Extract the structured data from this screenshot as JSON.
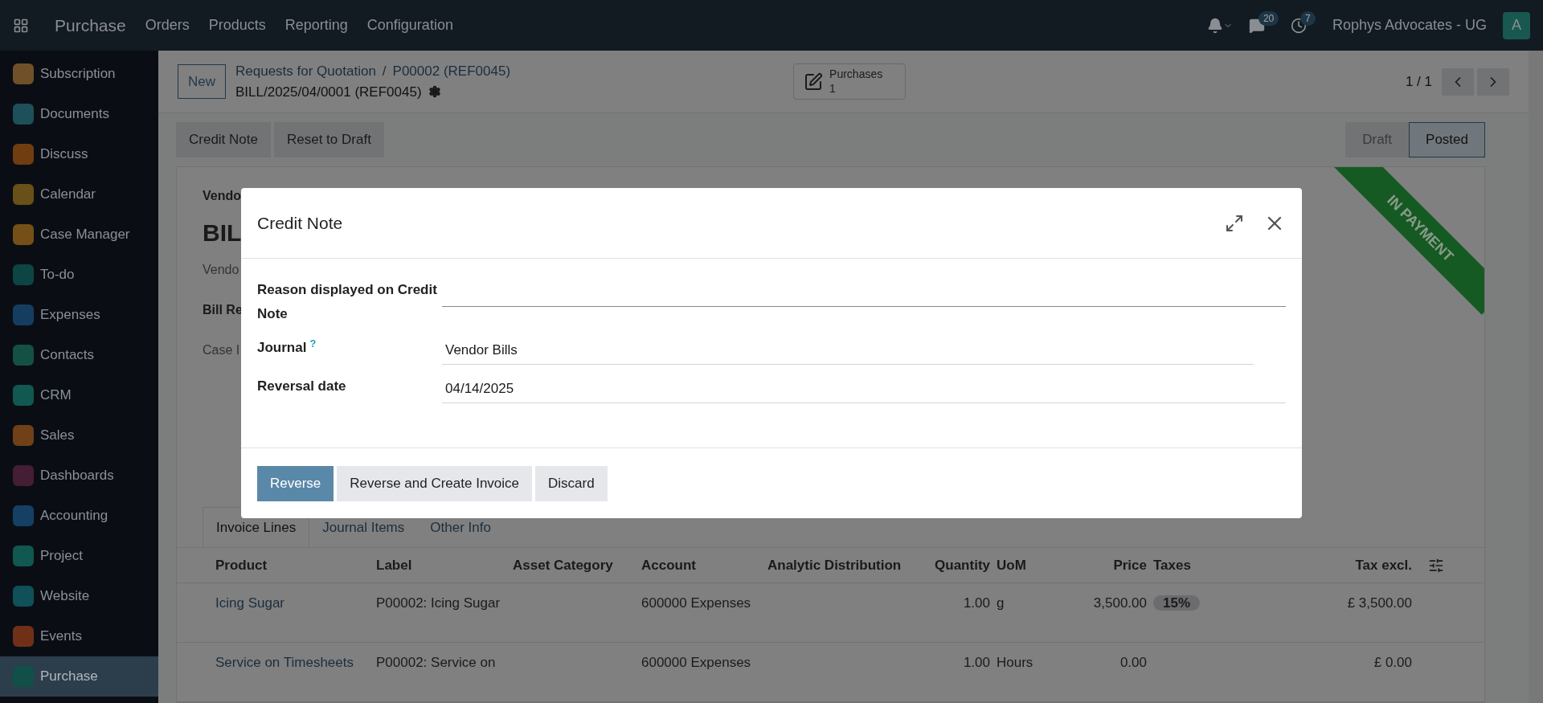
{
  "topbar": {
    "app": "Purchase",
    "menu": [
      "Orders",
      "Products",
      "Reporting",
      "Configuration"
    ],
    "messages_count": "20",
    "activities_count": "7",
    "company": "Rophys Advocates - UG",
    "avatar": "A"
  },
  "sidebar": {
    "items": [
      {
        "label": "Subscription",
        "color": "#705028",
        "selected": false
      },
      {
        "label": "Documents",
        "color": "#1d5058",
        "selected": false
      },
      {
        "label": "Discuss",
        "color": "#703d10",
        "selected": false
      },
      {
        "label": "Calendar",
        "color": "#685018",
        "selected": false
      },
      {
        "label": "Case Manager",
        "color": "#745018",
        "selected": false
      },
      {
        "label": "To-do",
        "color": "#0d4545",
        "selected": false
      },
      {
        "label": "Expenses",
        "color": "#153d60",
        "selected": false
      },
      {
        "label": "Contacts",
        "color": "#155045",
        "selected": false
      },
      {
        "label": "CRM",
        "color": "#105850",
        "selected": false
      },
      {
        "label": "Sales",
        "color": "#704018",
        "selected": false
      },
      {
        "label": "Dashboards",
        "color": "#451d35",
        "selected": false
      },
      {
        "label": "Accounting",
        "color": "#154064",
        "selected": false
      },
      {
        "label": "Project",
        "color": "#105850",
        "selected": false
      },
      {
        "label": "Website",
        "color": "#105058",
        "selected": false
      },
      {
        "label": "Events",
        "color": "#703018",
        "selected": false
      },
      {
        "label": "Purchase",
        "color": "#105048",
        "selected": true
      }
    ]
  },
  "control_panel": {
    "new_button": "New",
    "breadcrumb": [
      "Requests for Quotation",
      "P00002 (REF0045)"
    ],
    "breadcrumb_separator": "/",
    "record": "BILL/2025/04/0001 (REF0045)",
    "smart_button": {
      "label": "Purchases",
      "count": "1"
    },
    "pager": "1 / 1"
  },
  "actions": [
    "Credit Note",
    "Reset to Draft"
  ],
  "status_steps": [
    {
      "label": "Draft",
      "selected": false
    },
    {
      "label": "Posted",
      "selected": true
    }
  ],
  "ribbon": "IN PAYMENT",
  "form_labels": [
    "Vendo",
    "Vendo",
    "Bill Re",
    "Case I"
  ],
  "form_title": "BIL",
  "tabs": [
    {
      "label": "Invoice Lines",
      "selected": true
    },
    {
      "label": "Journal Items",
      "selected": false
    },
    {
      "label": "Other Info",
      "selected": false
    }
  ],
  "table": {
    "columns": [
      "Product",
      "Label",
      "Asset Category",
      "Account",
      "Analytic Distribution",
      "Quantity",
      "UoM",
      "Price",
      "Taxes",
      "Tax excl."
    ],
    "rows": [
      {
        "product": "Icing Sugar",
        "label": "P00002: Icing Sugar",
        "account": "600000 Expenses",
        "quantity": "1.00",
        "uom": "g",
        "price": "3,500.00",
        "taxes": "15%",
        "total": "£ 3,500.00"
      },
      {
        "product": "Service on Timesheets",
        "label": "P00002: Service on",
        "account": "600000 Expenses",
        "quantity": "1.00",
        "uom": "Hours",
        "price": "0.00",
        "total": "£ 0.00"
      }
    ]
  },
  "dialog": {
    "title": "Credit Note",
    "fields": [
      {
        "label": "Reason displayed on Credit Note",
        "help": false,
        "kind": "text"
      },
      {
        "label": "Journal",
        "help_mark": "?",
        "value": "Vendor Bills",
        "help": true,
        "kind": "select"
      },
      {
        "label": "Reversal date",
        "value": "04/14/2025",
        "help": false,
        "kind": "date"
      }
    ],
    "buttons": [
      {
        "label": "Reverse",
        "kind": "primary"
      },
      {
        "label": "Reverse and Create Invoice",
        "kind": "secondary"
      },
      {
        "label": "Discard",
        "kind": "secondary"
      }
    ]
  }
}
